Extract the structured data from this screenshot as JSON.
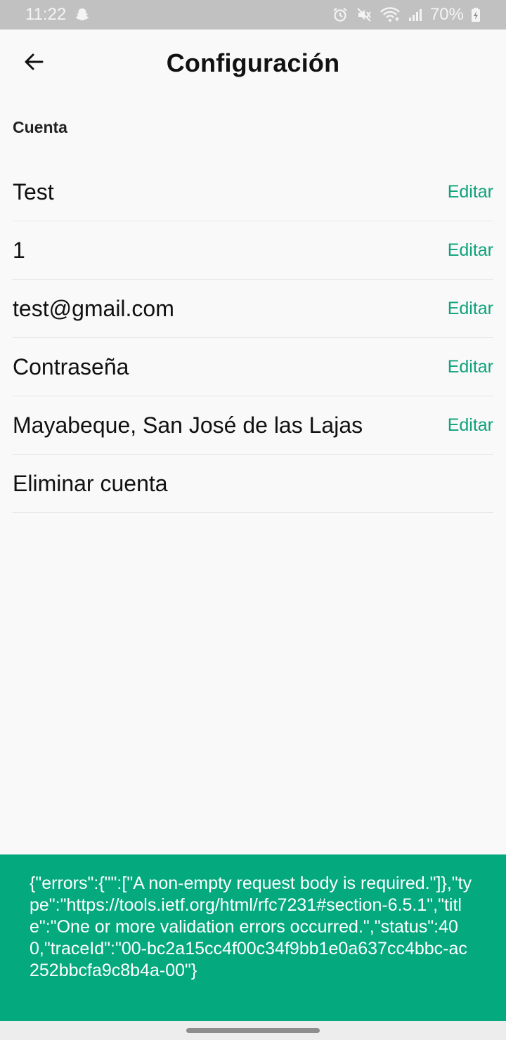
{
  "status_bar": {
    "time": "11:22",
    "battery": "70%",
    "icons": [
      "snapchat-ghost-icon",
      "alarm-icon",
      "mute-icon",
      "wifi-icon",
      "signal-icon",
      "battery-charging-icon"
    ]
  },
  "header": {
    "title": "Configuración",
    "back_icon": "arrow-left-icon"
  },
  "section": {
    "label": "Cuenta"
  },
  "rows": [
    {
      "label": "Test",
      "action": "Editar"
    },
    {
      "label": "1",
      "action": "Editar"
    },
    {
      "label": "test@gmail.com",
      "action": "Editar"
    },
    {
      "label": "Contraseña",
      "action": "Editar"
    },
    {
      "label": "Mayabeque, San José de las Lajas",
      "action": "Editar"
    },
    {
      "label": "Eliminar cuenta",
      "action": ""
    }
  ],
  "snackbar": {
    "message": "{\"errors\":{\"\":[\"A non-empty request body is required.\"]},\"type\":\"https://tools.ietf.org/html/rfc7231#section-6.5.1\",\"title\":\"One or more validation errors occurred.\",\"status\":400,\"traceId\":\"00-bc2a15cc4f00c34f9bb1e0a637cc4bbc-ac252bbcfa9c8b4a-00\"}"
  },
  "colors": {
    "accent": "#0ea27b",
    "snackbar_bg": "#04a97e",
    "status_bar_bg": "#c1c1c1",
    "background": "#f9f9f9"
  }
}
